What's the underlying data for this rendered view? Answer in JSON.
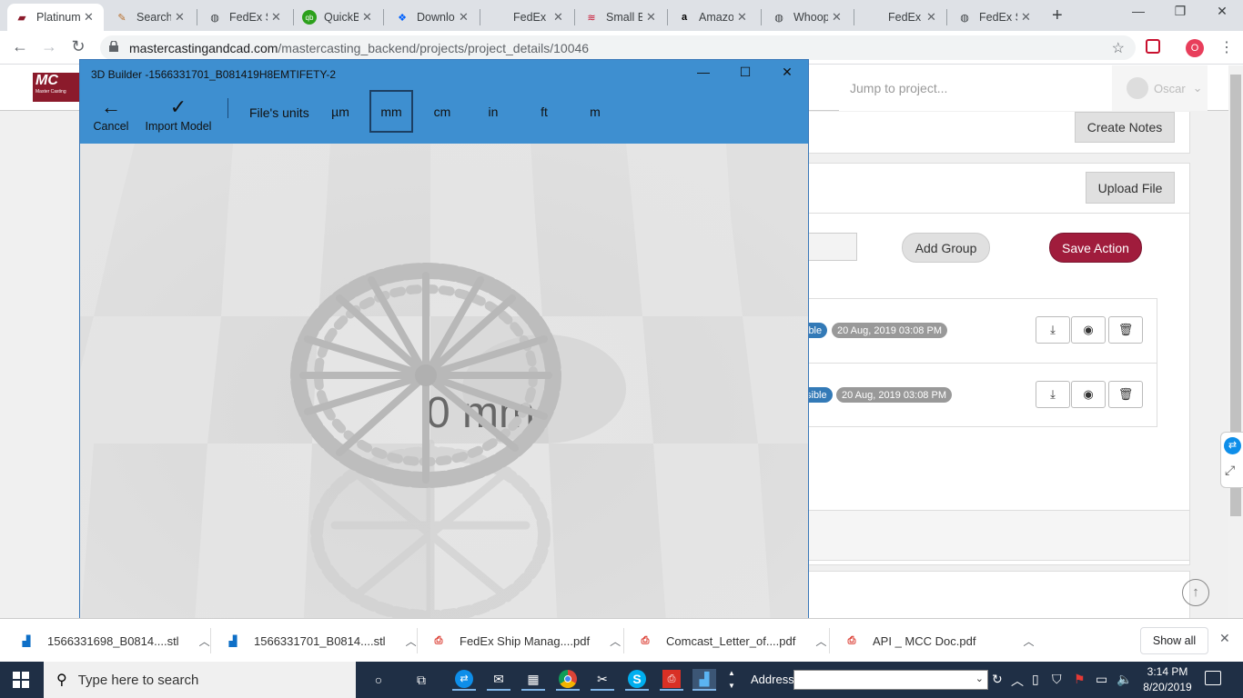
{
  "browser": {
    "tabs": [
      {
        "title": "Platinum",
        "icon": "mcc-logo-icon",
        "active": true
      },
      {
        "title": "Search",
        "icon": "search-favicon-icon"
      },
      {
        "title": "FedEx S",
        "icon": "globe-icon"
      },
      {
        "title": "QuickB",
        "icon": "quickbooks-icon"
      },
      {
        "title": "Downlo",
        "icon": "dropbox-icon"
      },
      {
        "title": "FedEx S",
        "icon": "globe-icon"
      },
      {
        "title": "Small B",
        "icon": "bank-icon"
      },
      {
        "title": "Amazo",
        "icon": "amazon-icon"
      },
      {
        "title": "Whoop",
        "icon": "globe-icon"
      },
      {
        "title": "FedEx S",
        "icon": "globe-icon"
      },
      {
        "title": "FedEx S",
        "icon": "globe-icon"
      }
    ],
    "url_domain": "mastercastingandcad.com",
    "url_path": "/mastercasting_backend/projects/project_details/10046",
    "profile_badge": "O"
  },
  "page": {
    "logo_text": "MC",
    "logo_sub": "Master Casting",
    "jump_placeholder": "Jump to project...",
    "user_name": "Oscar",
    "create_notes": "Create Notes",
    "upload_file": "Upload File",
    "add_group": "Add Group",
    "save_action": "Save Action",
    "files": [
      {
        "badge": "ible",
        "date": "20 Aug, 2019 03:08 PM"
      },
      {
        "badge": "sible",
        "date": "20 Aug, 2019 03:08 PM"
      }
    ]
  },
  "builder": {
    "window_title": "3D Builder -1566331701_B081419H8EMTIFETY-2",
    "cancel": "Cancel",
    "import_model": "Import Model",
    "units_label": "File's units",
    "units": [
      "µm",
      "mm",
      "cm",
      "in",
      "ft",
      "m"
    ],
    "selected_unit": "mm",
    "overlay_text": "0 mm"
  },
  "downloads": {
    "items": [
      {
        "name": "1566331698_B0814....stl",
        "icon": "3d-builder-file-icon"
      },
      {
        "name": "1566331701_B0814....stl",
        "icon": "3d-builder-file-icon"
      },
      {
        "name": "FedEx Ship Manag....pdf",
        "icon": "pdf-file-icon"
      },
      {
        "name": "Comcast_Letter_of....pdf",
        "icon": "pdf-file-icon"
      },
      {
        "name": "API _ MCC Doc.pdf",
        "icon": "pdf-file-icon"
      }
    ],
    "show_all": "Show all"
  },
  "taskbar": {
    "search_placeholder": "Type here to search",
    "address_label": "Address",
    "time": "3:14 PM",
    "date": "8/20/2019"
  },
  "colors": {
    "builder_titlebar": "#3e8fd0",
    "save_action": "#a01c3c",
    "badge_blue": "#337ab7",
    "badge_gray": "#999999",
    "taskbar": "#1f2f45"
  }
}
